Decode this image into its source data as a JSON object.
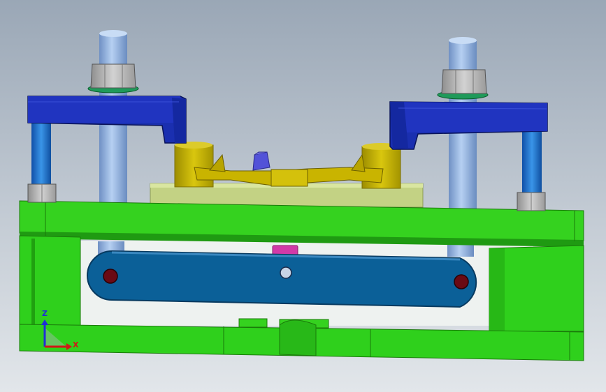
{
  "view": {
    "background_top": "#9aa7b6",
    "background_bottom": "#e2e6ea"
  },
  "triad": {
    "z_label": "Z",
    "x_label": "X",
    "z_color": "#1f2fd6",
    "x_color": "#d01818"
  },
  "parts": [
    {
      "name": "base-frame",
      "color": "#2ecc1a"
    },
    {
      "name": "clamp-arm-left",
      "color": "#1a2fb0"
    },
    {
      "name": "clamp-arm-right",
      "color": "#1a2fb0"
    },
    {
      "name": "threaded-rod",
      "color": "#8fb3e0"
    },
    {
      "name": "guide-pin",
      "color": "#1f6fd0"
    },
    {
      "name": "hex-nut",
      "color": "#b8b8b8"
    },
    {
      "name": "workpiece-fixture",
      "color": "#c8b400"
    },
    {
      "name": "locating-block",
      "color": "#4a4ad0"
    },
    {
      "name": "link-bar",
      "color": "#0a5f98"
    },
    {
      "name": "link-pin",
      "color": "#6a0a14"
    },
    {
      "name": "base-plate",
      "color": "#b8c870"
    }
  ]
}
